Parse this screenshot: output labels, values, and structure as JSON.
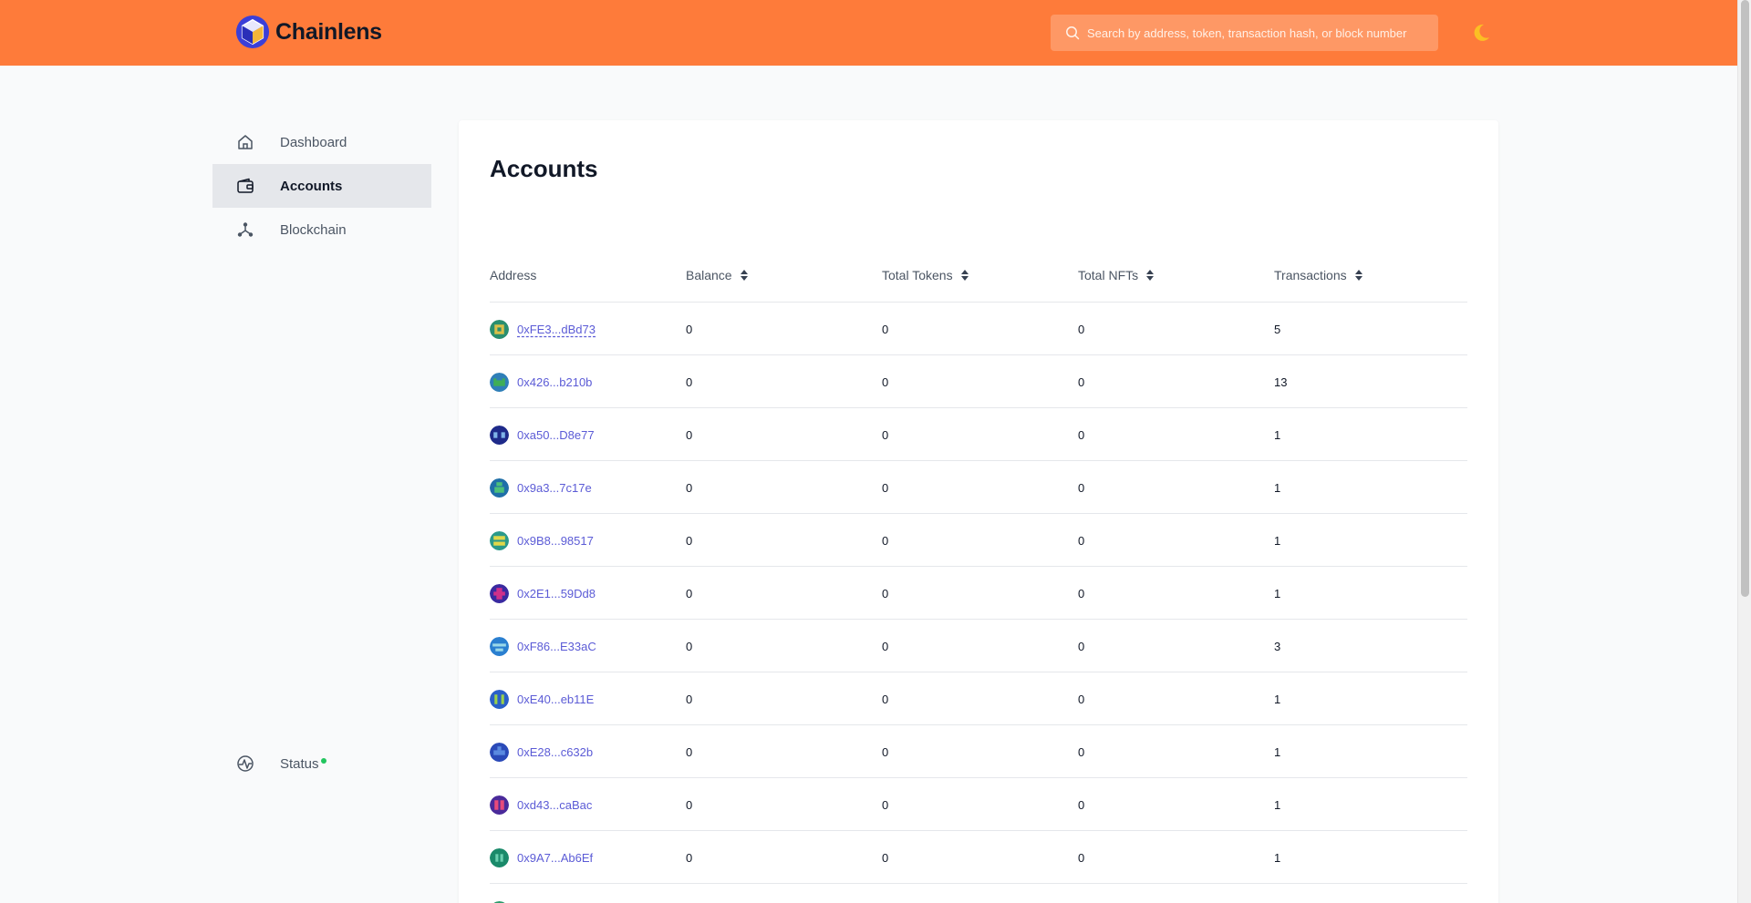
{
  "brand": {
    "name": "Chainlens"
  },
  "search": {
    "placeholder": "Search by address, token, transaction hash, or block number"
  },
  "sidebar": {
    "items": [
      {
        "label": "Dashboard",
        "icon": "home-icon",
        "active": false
      },
      {
        "label": "Accounts",
        "icon": "wallet-icon",
        "active": true
      },
      {
        "label": "Blockchain",
        "icon": "network-icon",
        "active": false
      }
    ],
    "status": {
      "label": "Status",
      "icon": "activity-icon",
      "indicator_color": "#22c55e"
    }
  },
  "colors": {
    "header": "#fe7b3a",
    "link": "#5b5bd6",
    "active_nav": "#e5e7eb"
  },
  "page": {
    "title": "Accounts",
    "columns": [
      "Address",
      "Balance",
      "Total Tokens",
      "Total NFTs",
      "Transactions"
    ],
    "rows": [
      {
        "address": "0xFE3...dBd73",
        "balance": "0",
        "tokens": "0",
        "nfts": "0",
        "transactions": "5",
        "avatar": [
          "#2a8f6f",
          "#d8c04a"
        ]
      },
      {
        "address": "0x426...b210b",
        "balance": "0",
        "tokens": "0",
        "nfts": "0",
        "transactions": "13",
        "avatar": [
          "#2f7fb8",
          "#3fae57"
        ]
      },
      {
        "address": "0xa50...D8e77",
        "balance": "0",
        "tokens": "0",
        "nfts": "0",
        "transactions": "1",
        "avatar": [
          "#1e2a8a",
          "#7fb3e8"
        ]
      },
      {
        "address": "0x9a3...7c17e",
        "balance": "0",
        "tokens": "0",
        "nfts": "0",
        "transactions": "1",
        "avatar": [
          "#1f6fa8",
          "#4cc07a"
        ]
      },
      {
        "address": "0x9B8...98517",
        "balance": "0",
        "tokens": "0",
        "nfts": "0",
        "transactions": "1",
        "avatar": [
          "#2b9a8a",
          "#e0d84a"
        ]
      },
      {
        "address": "0x2E1...59Dd8",
        "balance": "0",
        "tokens": "0",
        "nfts": "0",
        "transactions": "1",
        "avatar": [
          "#3a2aa0",
          "#d0308a"
        ]
      },
      {
        "address": "0xF86...E33aC",
        "balance": "0",
        "tokens": "0",
        "nfts": "0",
        "transactions": "3",
        "avatar": [
          "#2a7fd0",
          "#9ad8e8"
        ]
      },
      {
        "address": "0xE40...eb11E",
        "balance": "0",
        "tokens": "0",
        "nfts": "0",
        "transactions": "1",
        "avatar": [
          "#2a60c8",
          "#9ad04a"
        ]
      },
      {
        "address": "0xE28...c632b",
        "balance": "0",
        "tokens": "0",
        "nfts": "0",
        "transactions": "1",
        "avatar": [
          "#2a4ab8",
          "#5a8ae0"
        ]
      },
      {
        "address": "0xd43...caBac",
        "balance": "0",
        "tokens": "0",
        "nfts": "0",
        "transactions": "1",
        "avatar": [
          "#4a2a9a",
          "#e84a7a"
        ]
      },
      {
        "address": "0x9A7...Ab6Ef",
        "balance": "0",
        "tokens": "0",
        "nfts": "0",
        "transactions": "1",
        "avatar": [
          "#1a8a6a",
          "#6ad0b0"
        ]
      },
      {
        "address": "",
        "balance": "",
        "tokens": "",
        "nfts": "",
        "transactions": "",
        "avatar": [
          "#2a9a6a",
          "#8ad04a"
        ]
      }
    ]
  }
}
